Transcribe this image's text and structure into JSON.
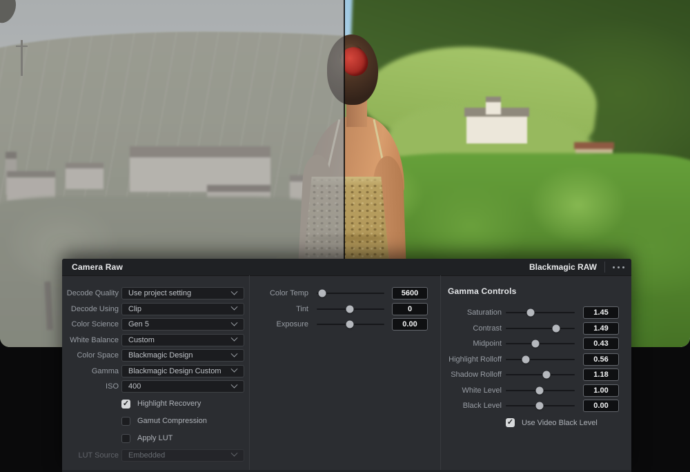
{
  "panel": {
    "title": "Camera Raw",
    "header_right": "Blackmagic RAW",
    "decode": {
      "rows": [
        {
          "label": "Decode Quality",
          "value": "Use project setting"
        },
        {
          "label": "Decode Using",
          "value": "Clip"
        },
        {
          "label": "Color Science",
          "value": "Gen 5"
        },
        {
          "label": "White Balance",
          "value": "Custom"
        },
        {
          "label": "Color Space",
          "value": "Blackmagic Design"
        },
        {
          "label": "Gamma",
          "value": "Blackmagic Design Custom"
        },
        {
          "label": "ISO",
          "value": "400"
        }
      ],
      "checkboxes": [
        {
          "label": "Highlight Recovery",
          "checked": true,
          "glyph": "✓"
        },
        {
          "label": "Gamut Compression",
          "checked": false,
          "glyph": ""
        },
        {
          "label": "Apply LUT",
          "checked": false,
          "glyph": ""
        }
      ],
      "lut_source": {
        "label": "LUT Source",
        "value": "Embedded",
        "disabled": true
      }
    },
    "sliders_main": [
      {
        "label": "Color Temp",
        "value": "5600",
        "pos_pct": "8%"
      },
      {
        "label": "Tint",
        "value": "0",
        "pos_pct": "49%"
      },
      {
        "label": "Exposure",
        "value": "0.00",
        "pos_pct": "49%"
      }
    ],
    "gamma_controls": {
      "title": "Gamma Controls",
      "sliders": [
        {
          "label": "Saturation",
          "value": "1.45",
          "pos_pct": "36%"
        },
        {
          "label": "Contrast",
          "value": "1.49",
          "pos_pct": "73%"
        },
        {
          "label": "Midpoint",
          "value": "0.43",
          "pos_pct": "43%"
        },
        {
          "label": "Highlight Rolloff",
          "value": "0.56",
          "pos_pct": "29%"
        },
        {
          "label": "Shadow Rolloff",
          "value": "1.18",
          "pos_pct": "59%"
        },
        {
          "label": "White Level",
          "value": "1.00",
          "pos_pct": "49%"
        },
        {
          "label": "Black Level",
          "value": "0.00",
          "pos_pct": "49%"
        }
      ],
      "checkbox": {
        "label": "Use Video Black Level",
        "checked": true,
        "glyph": "✓"
      }
    },
    "colors": {
      "panel_bg": "#2b2d31",
      "header_bg": "#1f2124",
      "field_bg": "#1b1c1f",
      "value_box_border": "#63666c",
      "slider_knob": "#b5b8bd",
      "checkbox_checked_bg": "#d7d9db"
    }
  }
}
